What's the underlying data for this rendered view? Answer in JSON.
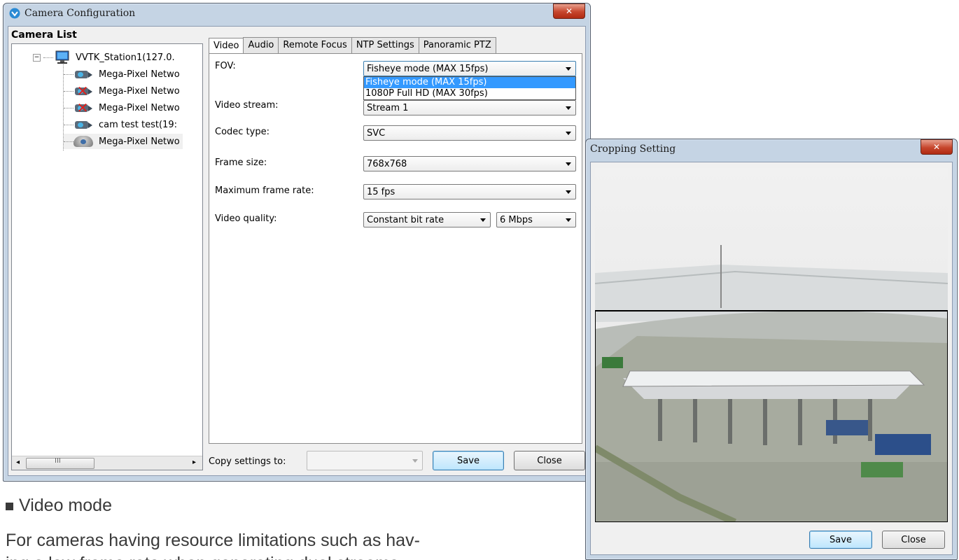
{
  "camera_config": {
    "title": "Camera Configuration",
    "camera_list_label": "Camera List",
    "tree": {
      "station": "VVTK_Station1(127.0.",
      "cameras": [
        {
          "label": "Mega-Pixel Netwo",
          "icon": "camera-icon"
        },
        {
          "label": "Mega-Pixel Netwo",
          "icon": "camera-disconnected-icon"
        },
        {
          "label": "Mega-Pixel Netwo",
          "icon": "camera-disconnected-icon"
        },
        {
          "label": "cam test test(19:",
          "icon": "camera-icon"
        },
        {
          "label": "Mega-Pixel Netwo",
          "icon": "dome-camera-icon"
        }
      ]
    },
    "tabs": [
      "Video",
      "Audio",
      "Remote Focus",
      "NTP Settings",
      "Panoramic PTZ"
    ],
    "fields": {
      "fov_label": "FOV:",
      "fov_value": "Fisheye mode (MAX 15fps)",
      "fov_options": [
        "Fisheye mode (MAX 15fps)",
        "1080P Full HD (MAX 30fps)"
      ],
      "video_stream_label": "Video stream:",
      "video_stream_value": "Stream 1",
      "codec_label": "Codec type:",
      "codec_value": "SVC",
      "frame_size_label": "Frame size:",
      "frame_size_value": "768x768",
      "max_frame_rate_label": "Maximum frame rate:",
      "max_frame_rate_value": "15 fps",
      "video_quality_label": "Video quality:",
      "video_quality_value": "Constant bit rate",
      "bitrate_value": "6 Mbps"
    },
    "copy_settings_label": "Copy settings to:",
    "save_label": "Save",
    "close_label": "Close"
  },
  "cropping": {
    "title": "Cropping Setting",
    "save_label": "Save",
    "close_label": "Close"
  },
  "document": {
    "heading": "Video mode",
    "body": "For cameras having resource limitations such as hav-",
    "body2": "ing a low frame rate when generating dual streams,"
  },
  "colors": {
    "selection": "#3399ff",
    "window_frame": "#c5d4e4",
    "close_button": "#c6452c"
  }
}
